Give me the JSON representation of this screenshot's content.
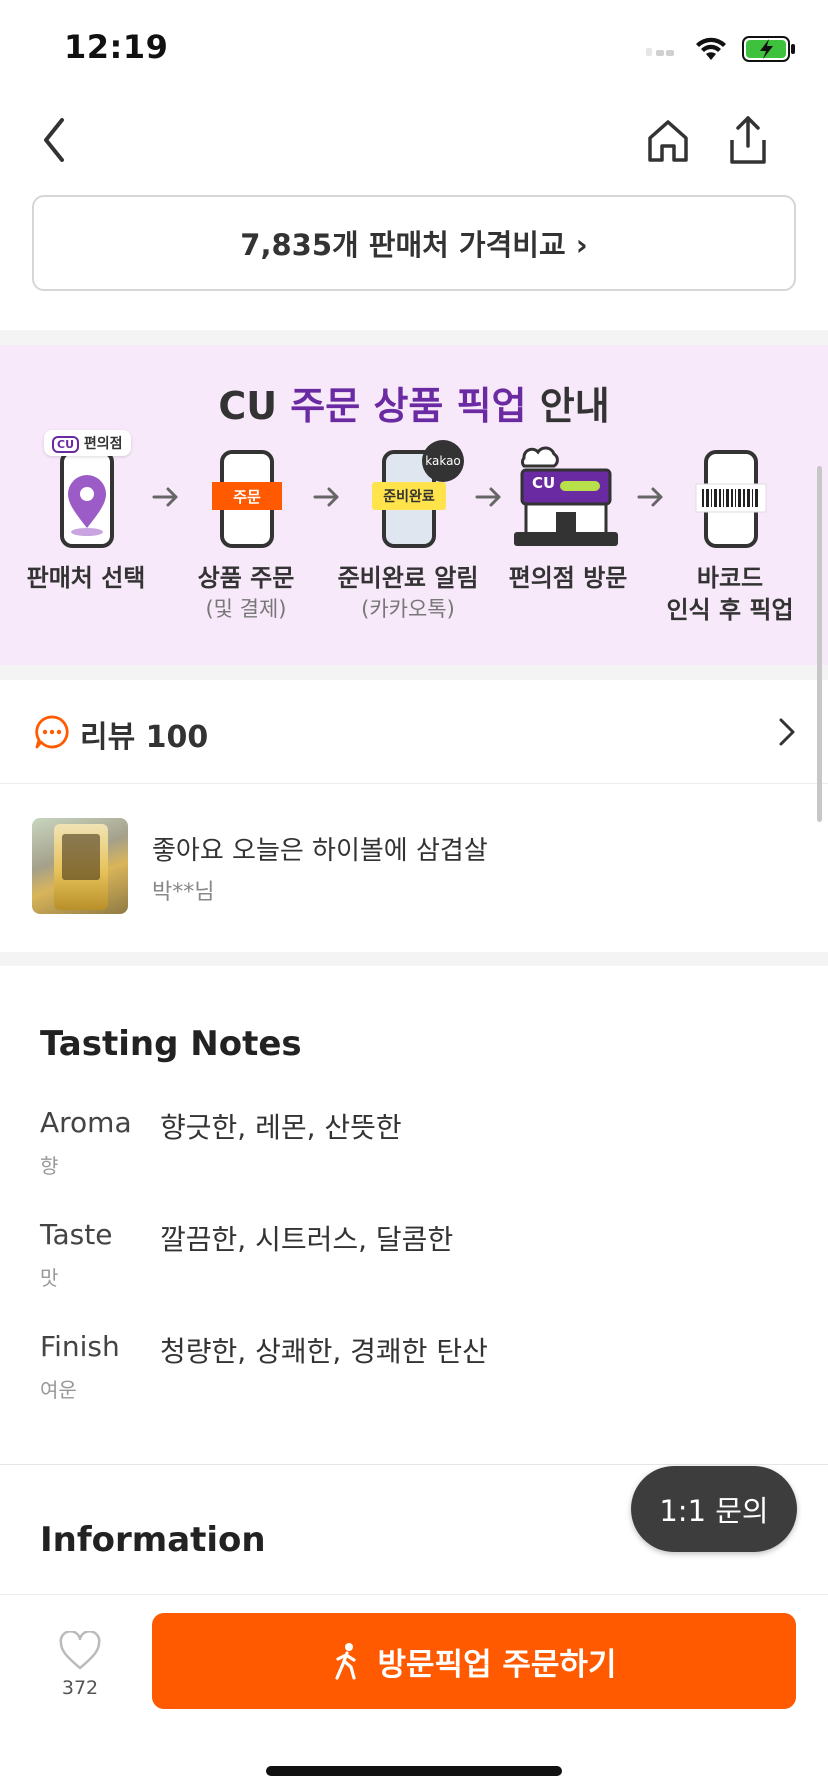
{
  "status_bar": {
    "time": "12:19"
  },
  "price_compare": {
    "label": "7,835개 판매처 가격비교 ›"
  },
  "pickup": {
    "title_prefix": "CU ",
    "title_highlight": "주문 상품 픽업",
    "title_suffix": " 안내",
    "accent_color": "#6a2aa2",
    "background": "#f8e9fa",
    "badges": {
      "store": "편의점",
      "cu": "CU",
      "order": "주문",
      "ready": "준비완료",
      "kakao": "kakao"
    },
    "steps": [
      {
        "label": "판매처 선택",
        "sub": "",
        "icon": "map-pin-phone-icon"
      },
      {
        "label": "상품 주문",
        "sub": "(및 결제)",
        "icon": "phone-order-icon"
      },
      {
        "label": "준비완료 알림",
        "sub": "(카카오톡)",
        "icon": "phone-notify-icon"
      },
      {
        "label": "편의점 방문",
        "sub": "",
        "icon": "store-icon"
      },
      {
        "label": "바코드",
        "sub": "인식 후 픽업",
        "icon": "phone-barcode-icon"
      }
    ]
  },
  "review": {
    "title": "리뷰 100",
    "item": {
      "text": "좋아요 오늘은 하이볼에 삼겹살",
      "author": "박**님"
    }
  },
  "tasting_notes": {
    "title": "Tasting Notes",
    "notes": [
      {
        "key": "Aroma",
        "key_sub": "향",
        "value": "향긋한, 레몬, 산뜻한"
      },
      {
        "key": "Taste",
        "key_sub": "맛",
        "value": "깔끔한, 시트러스, 달콤한"
      },
      {
        "key": "Finish",
        "key_sub": "여운",
        "value": "청량한, 상쾌한, 경쾌한 탄산"
      }
    ]
  },
  "information": {
    "title": "Information"
  },
  "inquiry": {
    "label": "1:1 문의"
  },
  "bottom_bar": {
    "like_count": "372",
    "order_label": "방문픽업 주문하기",
    "order_color": "#ff5a00"
  }
}
